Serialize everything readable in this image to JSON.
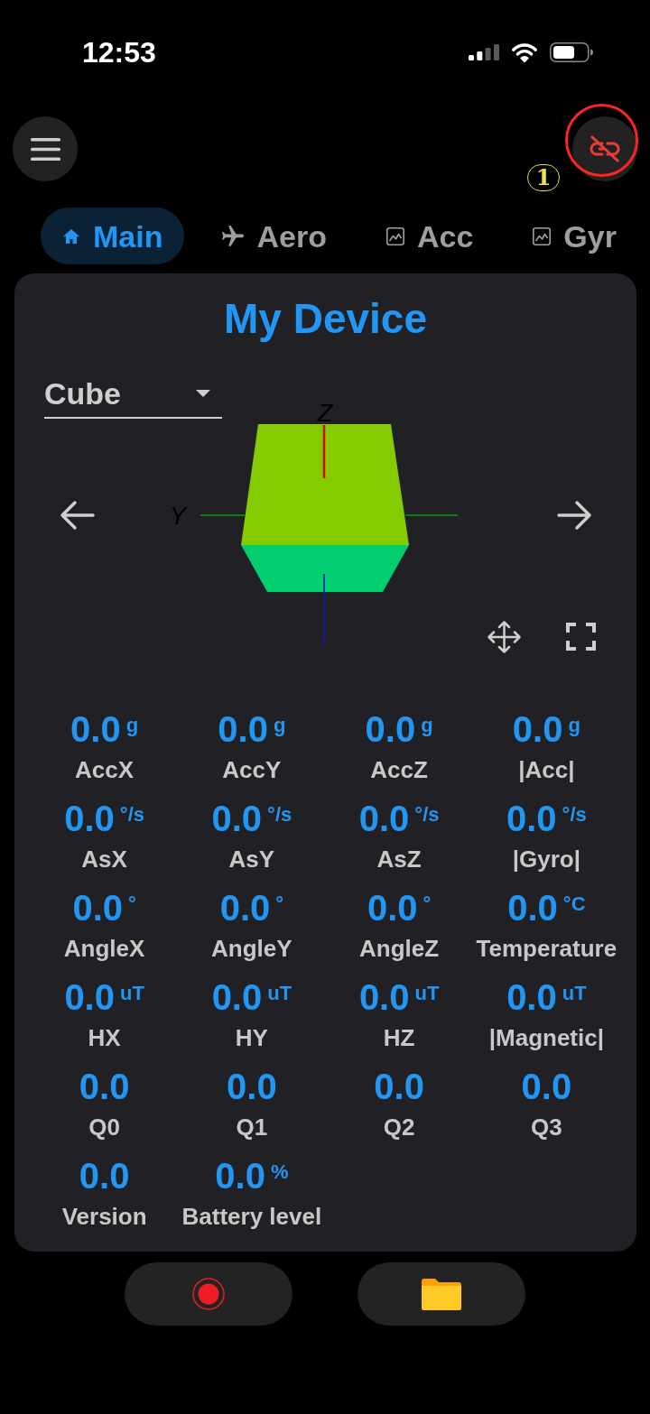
{
  "status_bar": {
    "time": "12:53"
  },
  "header": {
    "connection_button": {
      "highlighted": true
    },
    "annotation_marker": "1"
  },
  "tabs": [
    {
      "label": "Main",
      "kind": "home",
      "selected": true
    },
    {
      "label": "Aero",
      "kind": "plane",
      "selected": false
    },
    {
      "label": "Acc",
      "kind": "chart",
      "selected": false
    },
    {
      "label": "Gyr",
      "kind": "chart",
      "selected": false
    }
  ],
  "card": {
    "title": "My Device",
    "model_select": {
      "value": "Cube"
    },
    "viewer": {
      "axis_labels": [
        "Y",
        "Z"
      ]
    },
    "readings": [
      {
        "value": "0.0",
        "unit": "g",
        "label": "AccX"
      },
      {
        "value": "0.0",
        "unit": "g",
        "label": "AccY"
      },
      {
        "value": "0.0",
        "unit": "g",
        "label": "AccZ"
      },
      {
        "value": "0.0",
        "unit": "g",
        "label": "|Acc|"
      },
      {
        "value": "0.0",
        "unit": "°/s",
        "label": "AsX"
      },
      {
        "value": "0.0",
        "unit": "°/s",
        "label": "AsY"
      },
      {
        "value": "0.0",
        "unit": "°/s",
        "label": "AsZ"
      },
      {
        "value": "0.0",
        "unit": "°/s",
        "label": "|Gyro|"
      },
      {
        "value": "0.0",
        "unit": "°",
        "label": "AngleX"
      },
      {
        "value": "0.0",
        "unit": "°",
        "label": "AngleY"
      },
      {
        "value": "0.0",
        "unit": "°",
        "label": "AngleZ"
      },
      {
        "value": "0.0",
        "unit": "°C",
        "label": "Temperature"
      },
      {
        "value": "0.0",
        "unit": "uT",
        "label": "HX"
      },
      {
        "value": "0.0",
        "unit": "uT",
        "label": "HY"
      },
      {
        "value": "0.0",
        "unit": "uT",
        "label": "HZ"
      },
      {
        "value": "0.0",
        "unit": "uT",
        "label": "|Magnetic|"
      },
      {
        "value": "0.0",
        "label": "Q0"
      },
      {
        "value": "0.0",
        "label": "Q1"
      },
      {
        "value": "0.0",
        "label": "Q2"
      },
      {
        "value": "0.0",
        "label": "Q3"
      },
      {
        "value": "0.0",
        "label": "Version"
      },
      {
        "value": "0.0",
        "unit": "%",
        "label": "Battery level"
      }
    ]
  }
}
